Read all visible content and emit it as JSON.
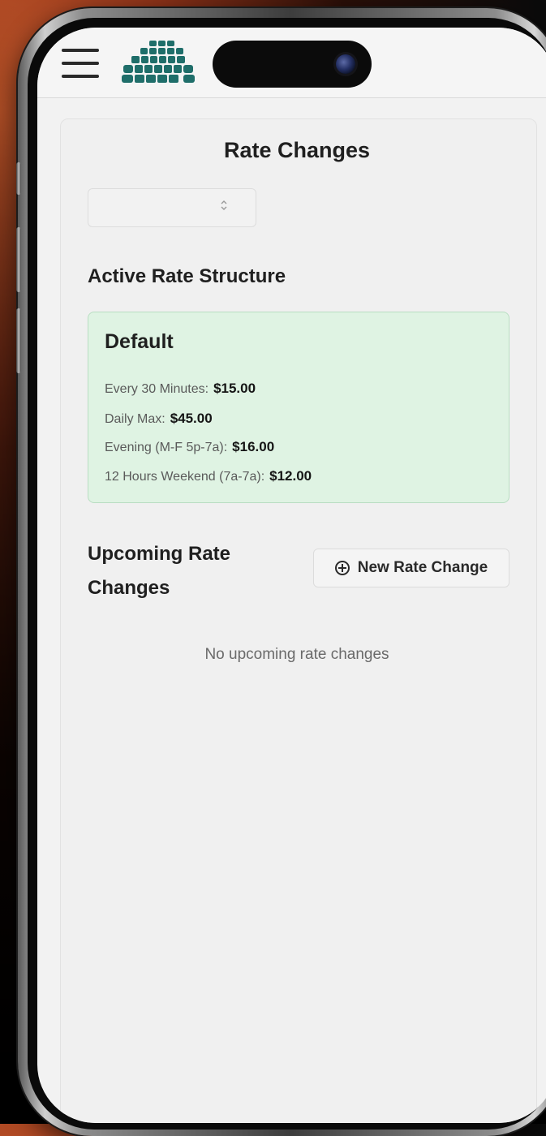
{
  "header": {
    "menu_icon": "hamburger-menu-icon",
    "logo_icon": "parking-grid-logo-icon"
  },
  "page": {
    "title": "Rate Changes"
  },
  "selector": {
    "value": "",
    "arrow_icon": "chevron-up-down-icon"
  },
  "active_section": {
    "title": "Active Rate Structure",
    "structure": {
      "name": "Default",
      "rates": [
        {
          "label": "Every 30 Minutes:",
          "amount": "$15.00"
        },
        {
          "label": "Daily Max:",
          "amount": "$45.00"
        },
        {
          "label": "Evening (M-F 5p-7a):",
          "amount": "$16.00"
        },
        {
          "label": "12 Hours Weekend (7a-7a):",
          "amount": "$12.00"
        }
      ]
    },
    "accent_color": "#dff3e3"
  },
  "upcoming_section": {
    "title_line1": "Upcoming Rate",
    "title_line2": "Changes",
    "new_button_label": "New Rate Change",
    "new_button_icon": "plus-circle-icon",
    "empty_message": "No upcoming rate changes"
  }
}
